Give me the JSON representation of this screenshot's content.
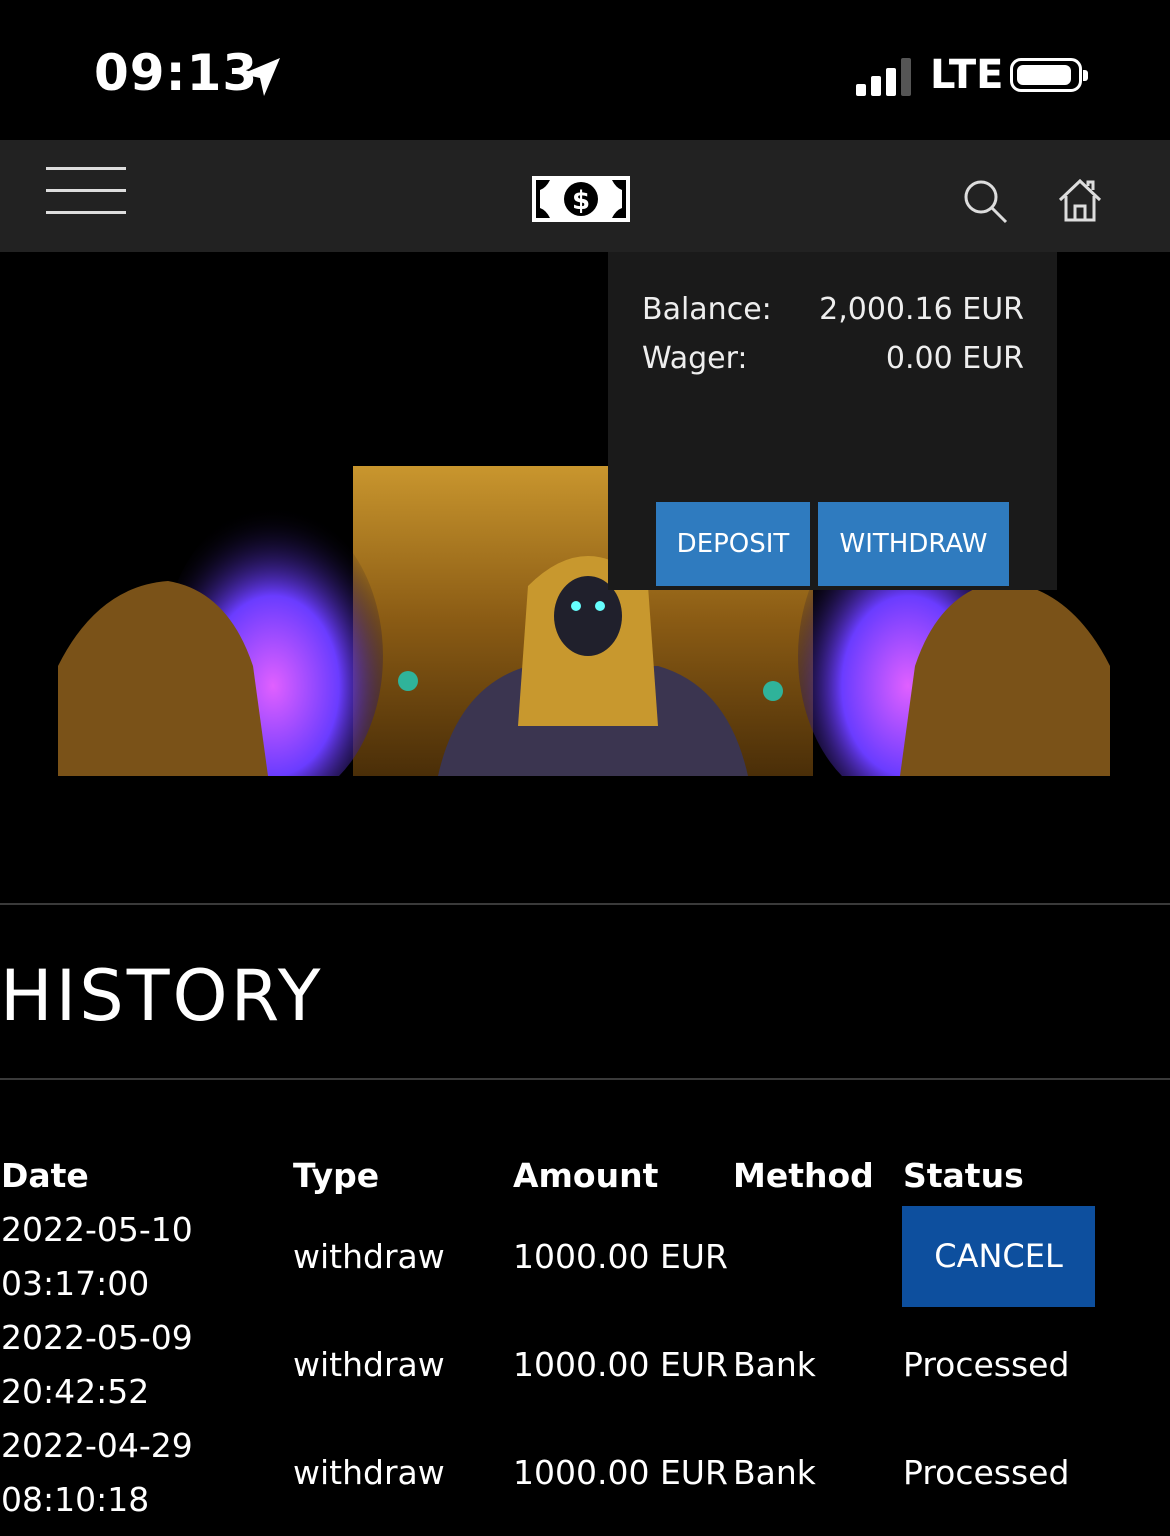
{
  "status_bar": {
    "time": "09:13",
    "network": "LTE",
    "icons": [
      "location-arrow-icon",
      "signal-icon",
      "battery-icon"
    ]
  },
  "nav": {
    "icons": [
      "hamburger-menu-icon",
      "cash-logo-icon",
      "search-icon",
      "home-icon"
    ]
  },
  "wallet": {
    "balance_label": "Balance:",
    "balance_value": "2,000.16 EUR",
    "wager_label": "Wager:",
    "wager_value": "0.00 EUR",
    "deposit_label": "DEPOSIT",
    "withdraw_label": "WITHDRAW"
  },
  "history": {
    "title": "HISTORY",
    "columns": [
      "Date",
      "Type",
      "Amount",
      "Method",
      "Status"
    ],
    "rows": [
      {
        "date": "2022-05-10",
        "time": "03:17:00",
        "type": "withdraw",
        "amount": "1000.00 EUR",
        "method": "",
        "status": "CANCEL"
      },
      {
        "date": "2022-05-09",
        "time": "20:42:52",
        "type": "withdraw",
        "amount": "1000.00 EUR",
        "method": "Bank",
        "status": "Processed"
      },
      {
        "date": "2022-04-29",
        "time": "08:10:18",
        "type": "withdraw",
        "amount": "1000.00 EUR",
        "method": "Bank",
        "status": "Processed"
      }
    ]
  },
  "colors": {
    "nav_bg": "#222222",
    "button_blue": "#2f7bbf",
    "cancel_blue": "#0d4f9e"
  }
}
